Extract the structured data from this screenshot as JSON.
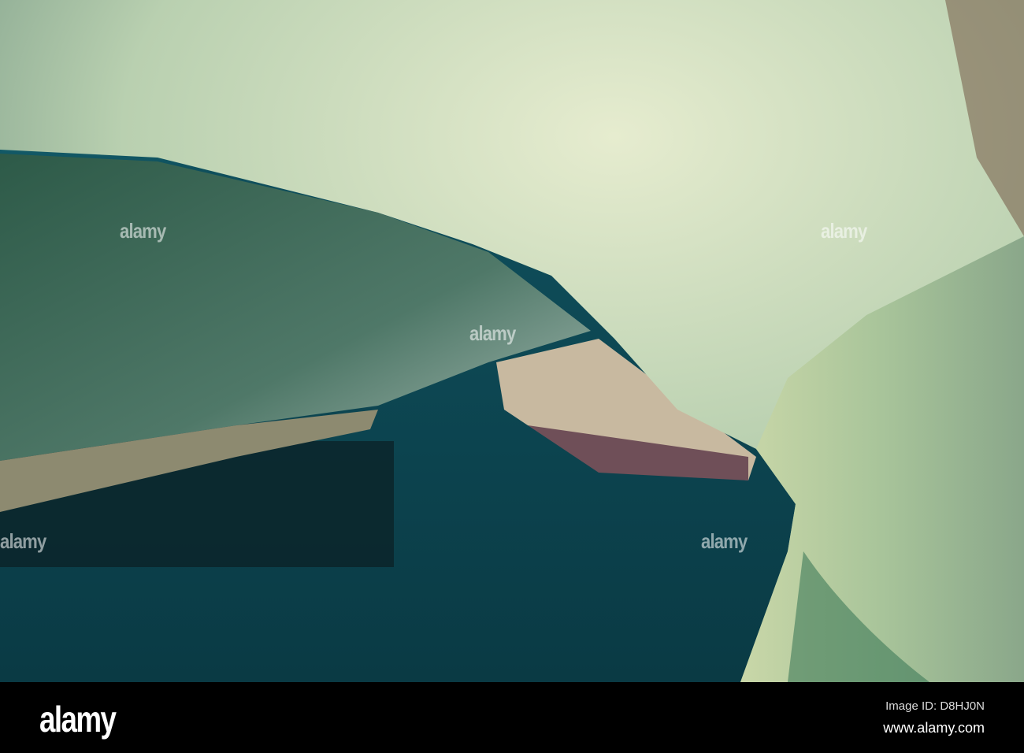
{
  "watermark": {
    "text": "alamy"
  },
  "footer": {
    "logo": "alamy",
    "image_id": "Image ID: D8HJ0N",
    "website": "www.alamy.com"
  }
}
